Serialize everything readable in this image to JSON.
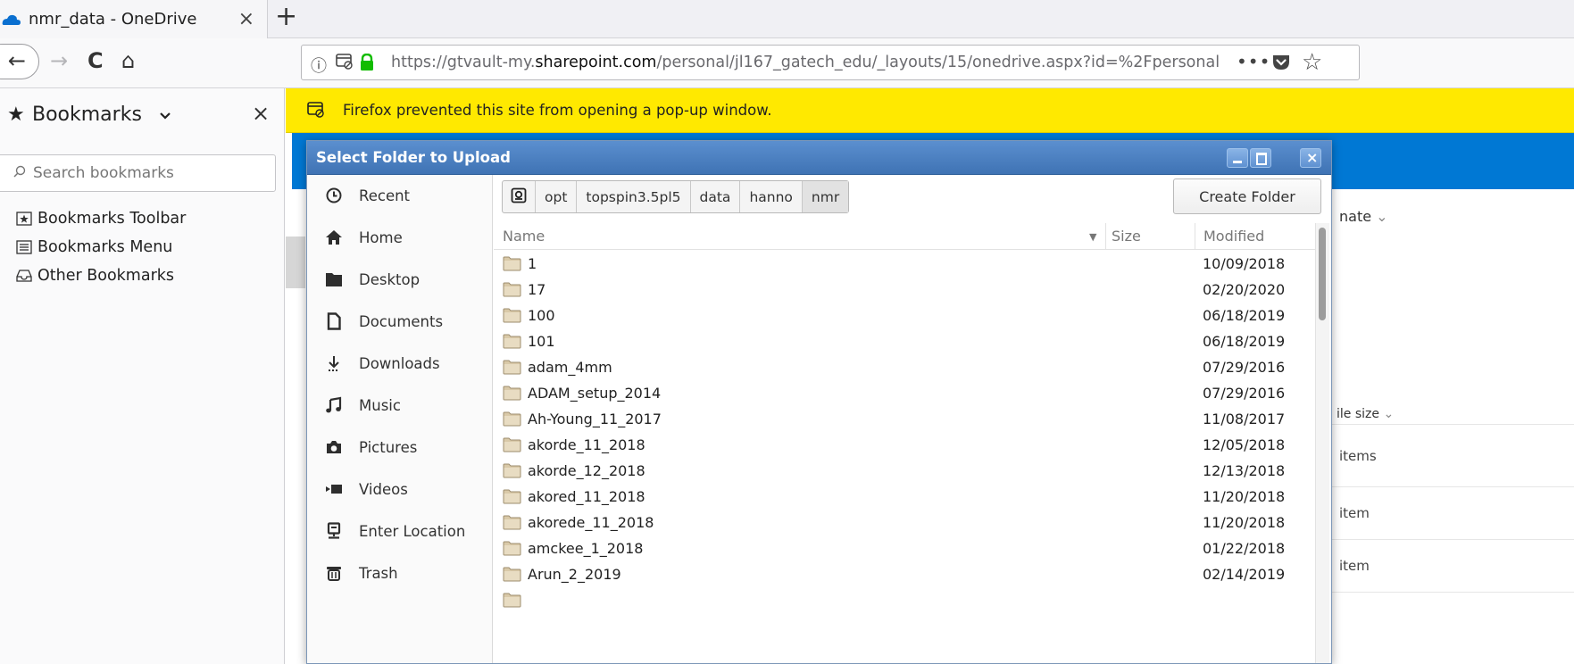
{
  "tab": {
    "title": "nmr_data - OneDrive",
    "close": "×",
    "new_tab": "+"
  },
  "nav": {
    "back": "←",
    "forward": "→",
    "reload": "C",
    "home": "⌂",
    "url_prefix": "https://gtvault-my.",
    "url_domain": "sharepoint.com",
    "url_path": "/personal/jl167_gatech_edu/_layouts/15/onedrive.aspx?id=%2Fpersonal",
    "info": "ⓘ",
    "more": "•••",
    "star": "☆"
  },
  "sidebar": {
    "title": "Bookmarks",
    "chevron": "⌄",
    "close": "×",
    "search_placeholder": "Search bookmarks",
    "items": [
      {
        "label": "Bookmarks Toolbar",
        "icon": "toolbar-star-icon"
      },
      {
        "label": "Bookmarks Menu",
        "icon": "menu-list-icon"
      },
      {
        "label": "Other Bookmarks",
        "icon": "inbox-tray-icon"
      }
    ]
  },
  "notification": {
    "text": "Firefox prevented this site from opening a pop-up window."
  },
  "onedrive": {
    "col_name_fragment": "nate",
    "col_size_fragment": "ile size",
    "cells": [
      "items",
      "item",
      "item"
    ]
  },
  "dialog": {
    "title": "Select Folder to Upload",
    "places": [
      {
        "label": "Recent",
        "icon": "recent-clock-icon"
      },
      {
        "label": "Home",
        "icon": "home-icon"
      },
      {
        "label": "Desktop",
        "icon": "desktop-folder-icon"
      },
      {
        "label": "Documents",
        "icon": "document-icon"
      },
      {
        "label": "Downloads",
        "icon": "download-arrow-icon"
      },
      {
        "label": "Music",
        "icon": "music-note-icon"
      },
      {
        "label": "Pictures",
        "icon": "camera-icon"
      },
      {
        "label": "Videos",
        "icon": "video-camera-icon"
      },
      {
        "label": "Enter Location",
        "icon": "location-pin-icon"
      },
      {
        "label": "Trash",
        "icon": "trash-icon"
      }
    ],
    "breadcrumb": [
      "opt",
      "topspin3.5pl5",
      "data",
      "hanno",
      "nmr"
    ],
    "create_folder": "Create Folder",
    "columns": {
      "name": "Name",
      "sort": "▼",
      "size": "Size",
      "modified": "Modified"
    },
    "rows": [
      {
        "name": "1",
        "modified": "10/09/2018"
      },
      {
        "name": "17",
        "modified": "02/20/2020"
      },
      {
        "name": "100",
        "modified": "06/18/2019"
      },
      {
        "name": "101",
        "modified": "06/18/2019"
      },
      {
        "name": "adam_4mm",
        "modified": "07/29/2016"
      },
      {
        "name": "ADAM_setup_2014",
        "modified": "07/29/2016"
      },
      {
        "name": "Ah-Young_11_2017",
        "modified": "11/08/2017"
      },
      {
        "name": "akorde_11_2018",
        "modified": "12/05/2018"
      },
      {
        "name": "akorde_12_2018",
        "modified": "12/13/2018"
      },
      {
        "name": "akored_11_2018",
        "modified": "11/20/2018"
      },
      {
        "name": "akorede_11_2018",
        "modified": "11/20/2018"
      },
      {
        "name": "amckee_1_2018",
        "modified": "01/22/2018"
      },
      {
        "name": "Arun_2_2019",
        "modified": "02/14/2019"
      }
    ]
  },
  "colors": {
    "accent": "#0078d4",
    "notification": "#ffe900",
    "titlebar": "#4a80c4"
  }
}
